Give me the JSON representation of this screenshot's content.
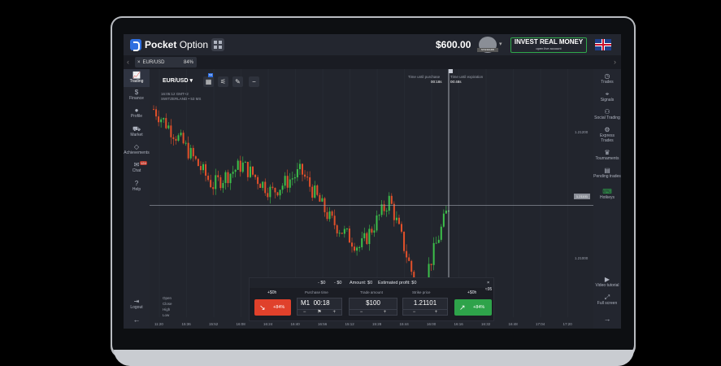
{
  "brand": {
    "name_bold": "Pocket",
    "name_light": " Option"
  },
  "header": {
    "balance": "$600.00",
    "avatar_label": "STANDARD",
    "invest_title": "INVEST REAL MONEY",
    "invest_sub": "open live account"
  },
  "tabs": {
    "asset": "EUR/USD",
    "asset_pct": "84%"
  },
  "left_sidebar": [
    {
      "label": "Trading",
      "icon": "chart-icon"
    },
    {
      "label": "Finance",
      "icon": "dollar-icon"
    },
    {
      "label": "Profile",
      "icon": "user-icon"
    },
    {
      "label": "Market",
      "icon": "cart-icon"
    },
    {
      "label": "Achievements",
      "icon": "diamond-icon"
    },
    {
      "label": "Chat",
      "icon": "chat-icon"
    },
    {
      "label": "Help",
      "icon": "help-icon"
    },
    {
      "label": "Logout",
      "icon": "logout-icon"
    }
  ],
  "chat_badge": "124",
  "right_sidebar": [
    {
      "label": "Trades",
      "icon": "clock-icon"
    },
    {
      "label": "Signals",
      "icon": "signal-icon"
    },
    {
      "label": "Social Trading",
      "icon": "social-icon"
    },
    {
      "label": "Express Trades",
      "icon": "express-icon"
    },
    {
      "label": "Tournaments",
      "icon": "trophy-icon"
    },
    {
      "label": "Pending trades",
      "icon": "pending-icon"
    },
    {
      "label": "Hotkeys",
      "icon": "keyboard-icon"
    },
    {
      "label": "Video tutorial",
      "icon": "video-icon"
    },
    {
      "label": "Full screen",
      "icon": "fullscreen-icon"
    }
  ],
  "chart_toolbar": {
    "pair": "EUR/USD",
    "badge": "M1"
  },
  "chart_info": {
    "time": "16:05:12 GMT+2",
    "market": "SWITZERLAND • 53 MS"
  },
  "timers": {
    "purchase_label": "Time until purchase",
    "purchase_val": "00:18s",
    "expiry_label": "Time until expiration",
    "expiry_val": "00:48s"
  },
  "ohlc": {
    "open": "Open",
    "close": "Close",
    "high": "High",
    "low": "Low"
  },
  "price_axis": {
    "p1": "1.21200",
    "p2": "1.21000",
    "current": "1.21101"
  },
  "time_axis": [
    "11:20",
    "15:36",
    "15:52",
    "16:08",
    "16:24",
    "16:40",
    "16:56",
    "15:12",
    "15:28",
    "15:44",
    "16:00",
    "16:16",
    "16:32",
    "16:48",
    "17:04",
    "17:20"
  ],
  "panel": {
    "bar": {
      "minus0_1": "- $0",
      "minus0_2": "- $0",
      "amount": "Amount: $0",
      "profit": "Estimated profit: $0"
    },
    "sell_pct": "+84%",
    "buy_pct": "+84%",
    "sell_cap": "+$0h",
    "buy_cap": "+$0h",
    "buy_cap2": "≈95",
    "purchase_time_label": "Purchase time",
    "purchase_mode": "M1",
    "purchase_time": "00:18",
    "trade_amount_label": "Trade amount",
    "trade_amount": "$100",
    "strike_label": "Strike price",
    "strike": "1.21101"
  },
  "chart_data": {
    "type": "candlestick",
    "x": [
      "15:20",
      "15:36",
      "15:52",
      "16:08",
      "16:24",
      "16:40",
      "16:56",
      "15:12",
      "15:28",
      "15:44",
      "16:00"
    ],
    "ohlc_close_approx": [
      1.2124,
      1.2119,
      1.2113,
      1.2116,
      1.2112,
      1.2115,
      1.2108,
      1.2104,
      1.2111,
      1.2097,
      1.211
    ],
    "current_price": 1.21101
  }
}
